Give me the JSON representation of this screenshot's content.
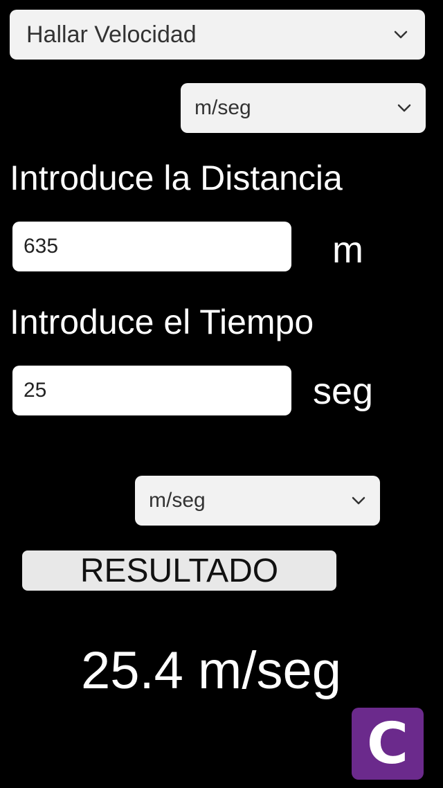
{
  "mode_select": {
    "value": "Hallar Velocidad",
    "icon": "chevron-down-icon"
  },
  "input_unit_select": {
    "value": "m/seg",
    "icon": "chevron-down-icon"
  },
  "distance": {
    "label": "Introduce la Distancia",
    "value": "635",
    "unit": "m"
  },
  "time": {
    "label": "Introduce el Tiempo",
    "value": "25",
    "unit": "seg"
  },
  "output_unit_select": {
    "value": "m/seg",
    "icon": "chevron-down-icon"
  },
  "result_button": {
    "label": "RESULTADO"
  },
  "result": {
    "text": "25.4 m/seg"
  },
  "clear_button": {
    "label": "C",
    "color": "#6b2a8c"
  },
  "colors": {
    "background": "#000000",
    "text": "#ffffff",
    "control": "#f2f2f2"
  }
}
